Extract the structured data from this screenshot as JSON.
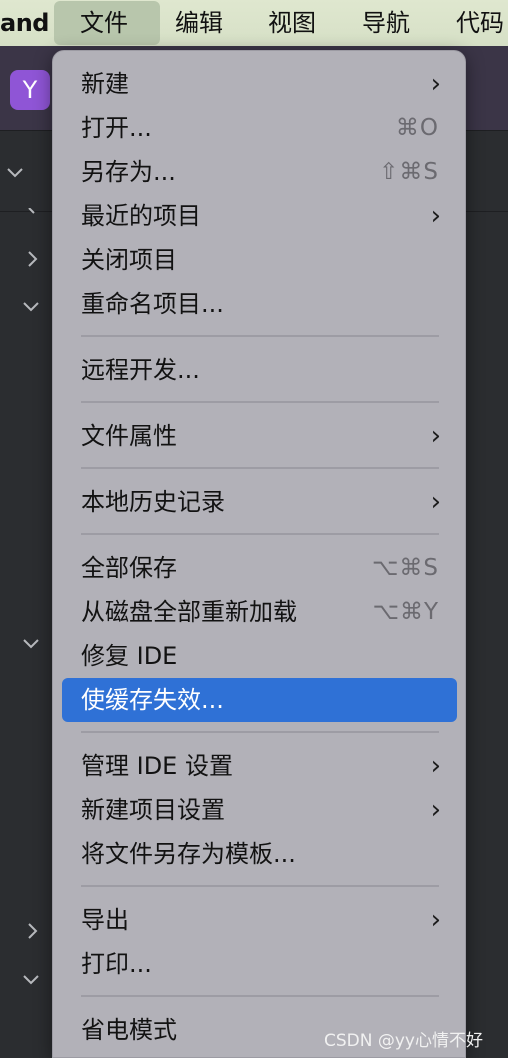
{
  "menubar": {
    "app_name": "and",
    "items": [
      "文件",
      "编辑",
      "视图",
      "导航",
      "代码"
    ]
  },
  "toolbar": {
    "avatar_letter": "Y"
  },
  "menu": {
    "items": [
      {
        "label": "新建",
        "submenu": true
      },
      {
        "label": "打开...",
        "shortcut": "⌘O"
      },
      {
        "label": "另存为...",
        "shortcut": "⇧⌘S"
      },
      {
        "label": "最近的项目",
        "submenu": true
      },
      {
        "label": "关闭项目"
      },
      {
        "label": "重命名项目..."
      },
      {
        "label": "远程开发..."
      },
      {
        "label": "文件属性",
        "submenu": true
      },
      {
        "label": "本地历史记录",
        "submenu": true
      },
      {
        "label": "全部保存",
        "shortcut": "⌥⌘S"
      },
      {
        "label": "从磁盘全部重新加载",
        "shortcut": "⌥⌘Y"
      },
      {
        "label": "修复 IDE"
      },
      {
        "label": "使缓存失效...",
        "highlighted": true
      },
      {
        "label": "管理 IDE 设置",
        "submenu": true
      },
      {
        "label": "新建项目设置",
        "submenu": true
      },
      {
        "label": "将文件另存为模板..."
      },
      {
        "label": "导出",
        "submenu": true
      },
      {
        "label": "打印..."
      },
      {
        "label": "省电模式"
      }
    ],
    "arrow_glyph": "›"
  },
  "watermark": "CSDN @yy心情不好",
  "colors": {
    "menubar_bg": "#d6e0c6",
    "menu_bg": "#b2b1b8",
    "highlight": "#2f71d6",
    "avatar": "#8f55d6"
  }
}
